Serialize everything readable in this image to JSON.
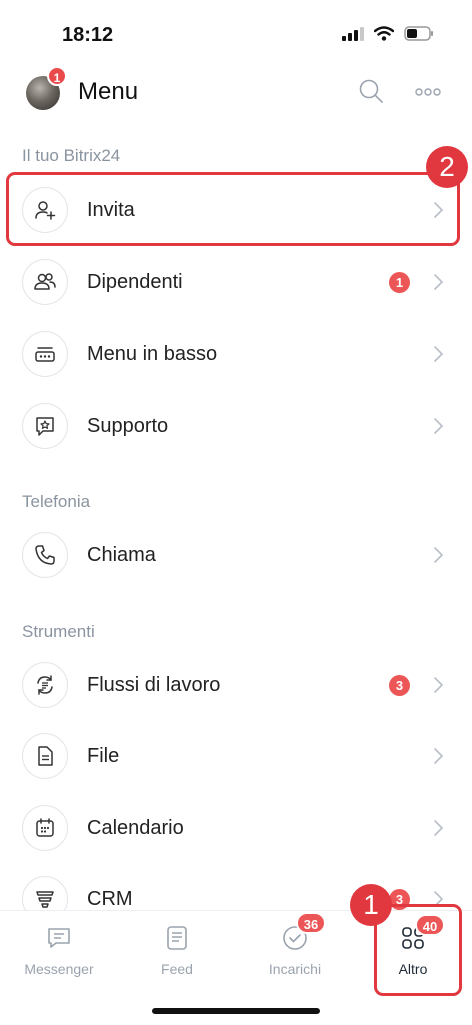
{
  "status": {
    "time": "18:12"
  },
  "header": {
    "title": "Menu",
    "avatar_badge": "1"
  },
  "sections": [
    {
      "label": "Il tuo Bitrix24"
    },
    {
      "label": "Telefonia"
    },
    {
      "label": "Strumenti"
    }
  ],
  "items": [
    {
      "label": "Invita",
      "icon": "add-user-icon"
    },
    {
      "label": "Dipendenti",
      "icon": "employees-icon",
      "count": "1"
    },
    {
      "label": "Menu in basso",
      "icon": "bottom-menu-icon"
    },
    {
      "label": "Supporto",
      "icon": "support-icon"
    },
    {
      "label": "Chiama",
      "icon": "phone-icon"
    },
    {
      "label": "Flussi di lavoro",
      "icon": "workflow-icon",
      "count": "3"
    },
    {
      "label": "File",
      "icon": "file-icon"
    },
    {
      "label": "Calendario",
      "icon": "calendar-icon"
    },
    {
      "label": "CRM",
      "icon": "crm-icon",
      "count": "3"
    }
  ],
  "annotations": {
    "step_1": "1",
    "step_2": "2",
    "highlight_color": "#e0383e"
  },
  "tabs": [
    {
      "label": "Messenger",
      "icon": "messenger-icon"
    },
    {
      "label": "Feed",
      "icon": "feed-icon"
    },
    {
      "label": "Incarichi",
      "icon": "tasks-icon",
      "badge": "36"
    },
    {
      "label": "Altro",
      "icon": "grid-icon",
      "badge": "40",
      "active": true
    }
  ]
}
